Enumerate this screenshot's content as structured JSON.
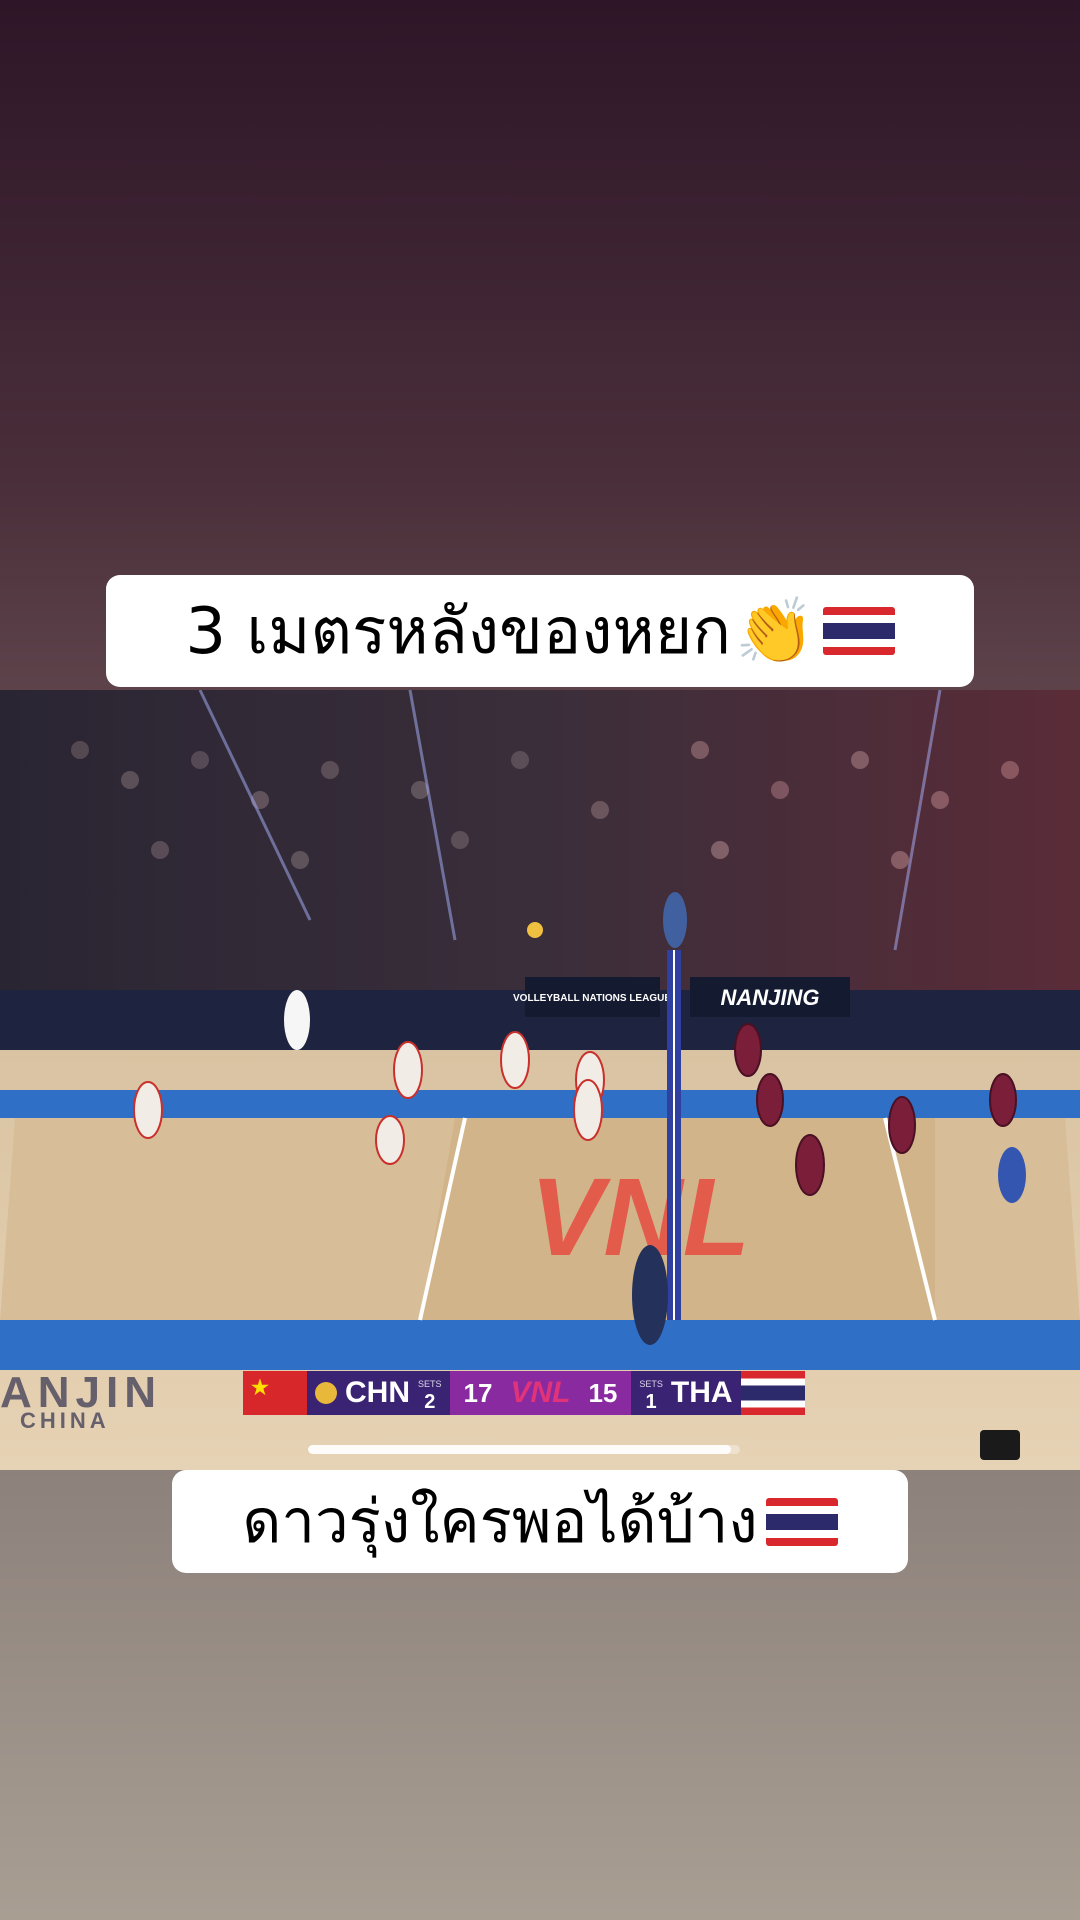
{
  "captions": {
    "top": {
      "text": "3 เมตรหลังของหยก",
      "emoji": "👏"
    },
    "bottom": {
      "text": "ดาวรุ่งใครพอได้บ้าง"
    }
  },
  "video": {
    "board_text": "NANJING",
    "ad_text": "VOLLEYBALL NATIONS LEAGUE",
    "court_logo": "VNL",
    "venue_watermark": "ANJIN",
    "venue_watermark_sub": "CHINA",
    "progress": 0.98
  },
  "scoreboard": {
    "home": {
      "code": "CHN",
      "sets": "2",
      "points": "17"
    },
    "away": {
      "code": "THA",
      "sets": "1",
      "points": "15"
    },
    "sets_label": "SETS",
    "league": "VNL"
  }
}
